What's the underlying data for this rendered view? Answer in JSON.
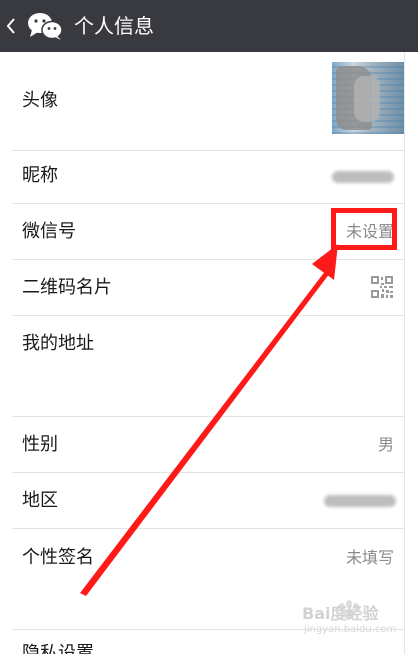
{
  "topbar": {
    "title": "个人信息"
  },
  "rows": {
    "avatar": {
      "label": "头像"
    },
    "nickname": {
      "label": "昵称"
    },
    "wechat_id": {
      "label": "微信号",
      "value": "未设置"
    },
    "qr_card": {
      "label": "二维码名片"
    },
    "address": {
      "label": "我的地址"
    },
    "gender": {
      "label": "性别",
      "value": "男"
    },
    "region": {
      "label": "地区"
    },
    "signature": {
      "label": "个性签名",
      "value": "未填写"
    }
  },
  "next_row": {
    "label": "隐私设置"
  },
  "watermark": {
    "text": "Bai度经验",
    "sub": "jingyan.baidu.com"
  },
  "colors": {
    "topbar_bg": "#393a3f",
    "annotation": "#ff1a1a",
    "value_gray": "#8a8a8a"
  },
  "icons": {
    "back": "chevron-left-icon",
    "logo": "wechat-logo-icon",
    "qr": "qr-code-icon"
  }
}
